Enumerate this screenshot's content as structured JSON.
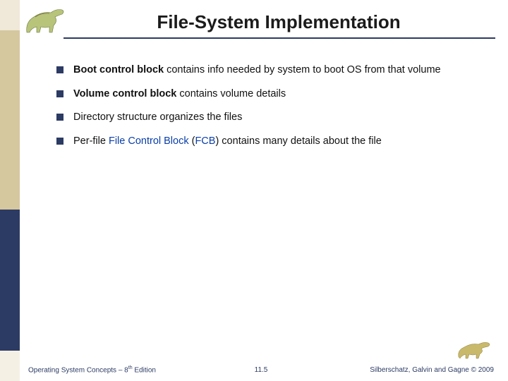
{
  "title": "File-System Implementation",
  "bullets": {
    "b1": {
      "bold": "Boot control block ",
      "rest": "contains info needed by system to boot OS from that volume"
    },
    "b2": {
      "bold": "Volume control block ",
      "rest": "contains volume details"
    },
    "b3": {
      "rest": "Directory structure organizes the files"
    },
    "b4": {
      "pre": "Per-file ",
      "link1": "File Control Block",
      "mid": " (",
      "link2": "FCB",
      "post": ") contains many details about the file"
    }
  },
  "footer": {
    "left_a": "Operating System Concepts – 8",
    "left_sup": "th",
    "left_b": " Edition",
    "center": "11.5",
    "right": "Silberschatz, Galvin and Gagne © 2009"
  }
}
